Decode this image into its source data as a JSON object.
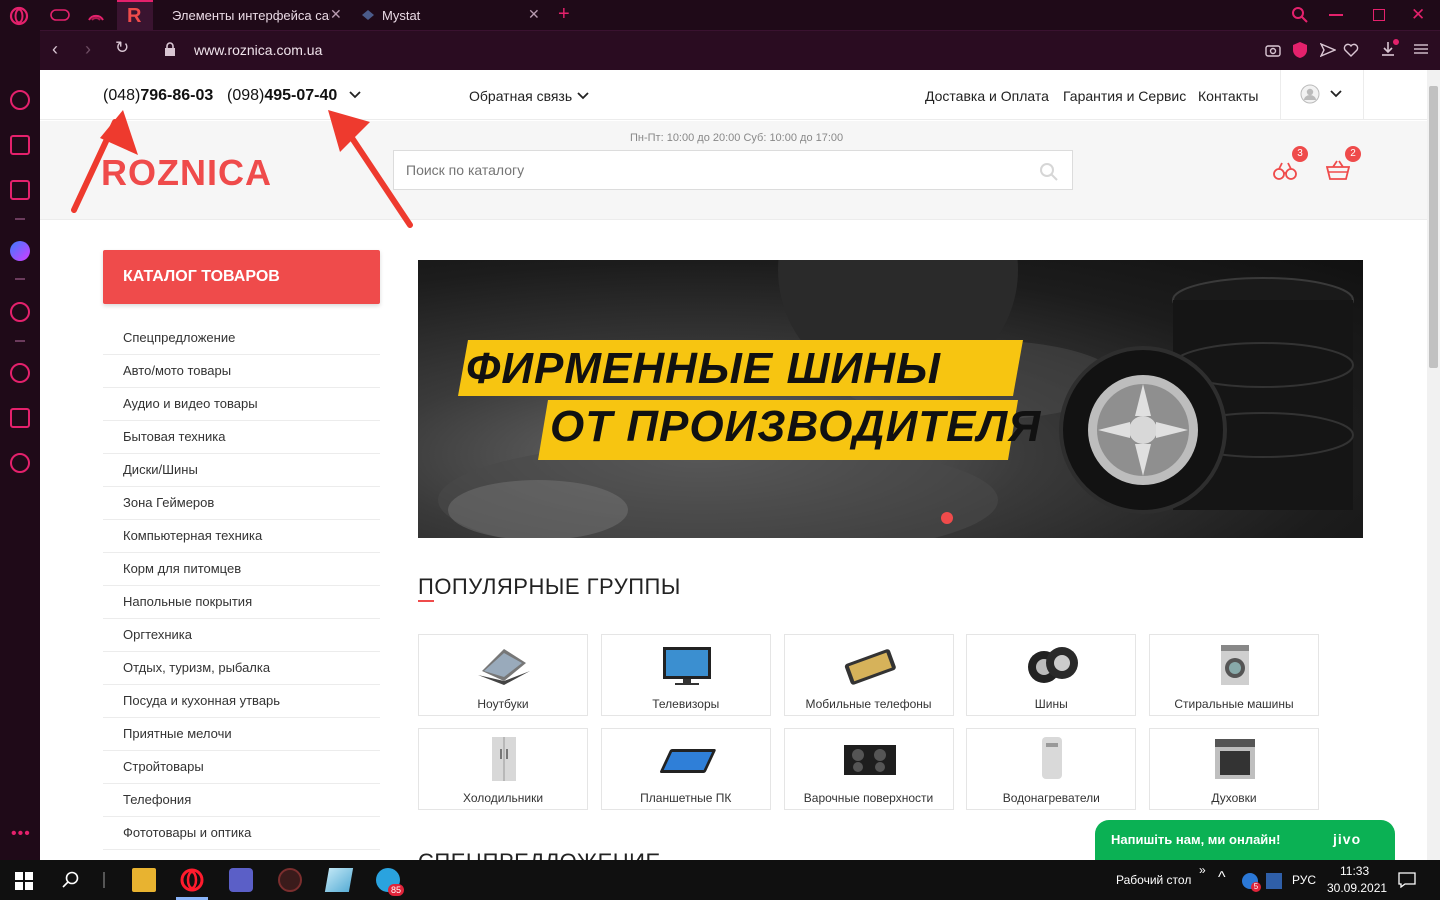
{
  "browser": {
    "tabs": [
      {
        "title": "Элементы интерфейса сайт"
      },
      {
        "title": "Mystat"
      }
    ],
    "url": "www.roznica.com.ua",
    "active_tab_letter": "R"
  },
  "site": {
    "phones": [
      {
        "code": "(048)",
        "number": "796-86-03"
      },
      {
        "code": "(098)",
        "number": "495-07-40"
      }
    ],
    "feedback_label": "Обратная связь",
    "nav": [
      "Доставка и Оплата",
      "Гарантия и Сервис",
      "Контакты"
    ],
    "hours": "Пн-Пт: 10:00 до 20:00 Суб: 10:00 до 17:00",
    "logo": "ROZNICA",
    "search_placeholder": "Поиск по каталогу",
    "compare_count": "3",
    "cart_count": "2",
    "catalog_button": "КАТАЛОГ ТОВАРОВ",
    "categories": [
      "Спецпредложение",
      "Авто/мото товары",
      "Аудио и видео товары",
      "Бытовая техника",
      "Диски/Шины",
      "Зона Геймеров",
      "Компьютерная техника",
      "Корм для питомцев",
      "Напольные покрытия",
      "Оргтехника",
      "Отдых, туризм, рыбалка",
      "Посуда и кухонная утварь",
      "Приятные мелочи",
      "Стройтовары",
      "Телефония",
      "Фототовары и оптика"
    ],
    "banner": {
      "line1": "ФИРМЕННЫЕ ШИНЫ",
      "line2": "ОТ ПРОИЗВОДИТЕЛЯ"
    },
    "popular_title": "ПОПУЛЯРНЫЕ ГРУППЫ",
    "popular_groups": [
      {
        "label": "Ноутбуки",
        "icon": "laptop-icon"
      },
      {
        "label": "Телевизоры",
        "icon": "tv-icon"
      },
      {
        "label": "Мобильные телефоны",
        "icon": "phone-icon"
      },
      {
        "label": "Шины",
        "icon": "tires-icon"
      },
      {
        "label": "Стиральные машины",
        "icon": "washer-icon"
      },
      {
        "label": "Холодильники",
        "icon": "fridge-icon"
      },
      {
        "label": "Планшетные ПК",
        "icon": "tablet-icon"
      },
      {
        "label": "Варочные поверхности",
        "icon": "cooktop-icon"
      },
      {
        "label": "Водонагреватели",
        "icon": "boiler-icon"
      },
      {
        "label": "Духовки",
        "icon": "oven-icon"
      }
    ],
    "special_title": "СПЕЦПРЕДЛОЖЕНИЕ",
    "jivo": {
      "text": "Напишіть нам, ми онлайн!",
      "brand": "jivo"
    }
  },
  "taskbar": {
    "desktop_label": "Рабочий стол",
    "lang": "РУС",
    "time": "11:33",
    "date": "30.09.2021",
    "telegram_badge": "85",
    "tray_badge": "5"
  },
  "colors": {
    "accent": "#ef4b4b",
    "browser_bg": "#1f0a18",
    "browser_accent": "#e4216c",
    "jivo_green": "#0bb154"
  }
}
